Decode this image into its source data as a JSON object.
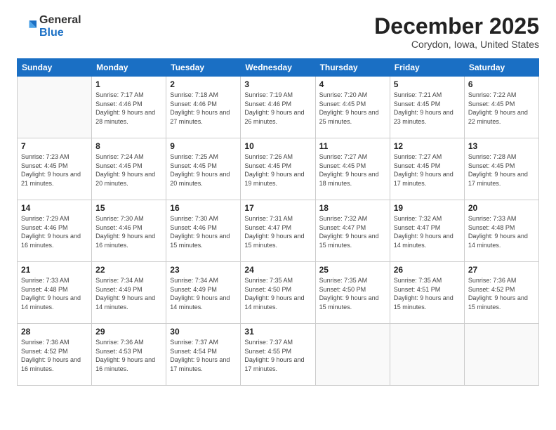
{
  "logo": {
    "general": "General",
    "blue": "Blue"
  },
  "title": "December 2025",
  "location": "Corydon, Iowa, United States",
  "weekdays": [
    "Sunday",
    "Monday",
    "Tuesday",
    "Wednesday",
    "Thursday",
    "Friday",
    "Saturday"
  ],
  "weeks": [
    [
      {
        "day": "",
        "sunrise": "",
        "sunset": "",
        "daylight": "",
        "empty": true
      },
      {
        "day": "1",
        "sunrise": "Sunrise: 7:17 AM",
        "sunset": "Sunset: 4:46 PM",
        "daylight": "Daylight: 9 hours and 28 minutes."
      },
      {
        "day": "2",
        "sunrise": "Sunrise: 7:18 AM",
        "sunset": "Sunset: 4:46 PM",
        "daylight": "Daylight: 9 hours and 27 minutes."
      },
      {
        "day": "3",
        "sunrise": "Sunrise: 7:19 AM",
        "sunset": "Sunset: 4:46 PM",
        "daylight": "Daylight: 9 hours and 26 minutes."
      },
      {
        "day": "4",
        "sunrise": "Sunrise: 7:20 AM",
        "sunset": "Sunset: 4:45 PM",
        "daylight": "Daylight: 9 hours and 25 minutes."
      },
      {
        "day": "5",
        "sunrise": "Sunrise: 7:21 AM",
        "sunset": "Sunset: 4:45 PM",
        "daylight": "Daylight: 9 hours and 23 minutes."
      },
      {
        "day": "6",
        "sunrise": "Sunrise: 7:22 AM",
        "sunset": "Sunset: 4:45 PM",
        "daylight": "Daylight: 9 hours and 22 minutes."
      }
    ],
    [
      {
        "day": "7",
        "sunrise": "Sunrise: 7:23 AM",
        "sunset": "Sunset: 4:45 PM",
        "daylight": "Daylight: 9 hours and 21 minutes."
      },
      {
        "day": "8",
        "sunrise": "Sunrise: 7:24 AM",
        "sunset": "Sunset: 4:45 PM",
        "daylight": "Daylight: 9 hours and 20 minutes."
      },
      {
        "day": "9",
        "sunrise": "Sunrise: 7:25 AM",
        "sunset": "Sunset: 4:45 PM",
        "daylight": "Daylight: 9 hours and 20 minutes."
      },
      {
        "day": "10",
        "sunrise": "Sunrise: 7:26 AM",
        "sunset": "Sunset: 4:45 PM",
        "daylight": "Daylight: 9 hours and 19 minutes."
      },
      {
        "day": "11",
        "sunrise": "Sunrise: 7:27 AM",
        "sunset": "Sunset: 4:45 PM",
        "daylight": "Daylight: 9 hours and 18 minutes."
      },
      {
        "day": "12",
        "sunrise": "Sunrise: 7:27 AM",
        "sunset": "Sunset: 4:45 PM",
        "daylight": "Daylight: 9 hours and 17 minutes."
      },
      {
        "day": "13",
        "sunrise": "Sunrise: 7:28 AM",
        "sunset": "Sunset: 4:45 PM",
        "daylight": "Daylight: 9 hours and 17 minutes."
      }
    ],
    [
      {
        "day": "14",
        "sunrise": "Sunrise: 7:29 AM",
        "sunset": "Sunset: 4:46 PM",
        "daylight": "Daylight: 9 hours and 16 minutes."
      },
      {
        "day": "15",
        "sunrise": "Sunrise: 7:30 AM",
        "sunset": "Sunset: 4:46 PM",
        "daylight": "Daylight: 9 hours and 16 minutes."
      },
      {
        "day": "16",
        "sunrise": "Sunrise: 7:30 AM",
        "sunset": "Sunset: 4:46 PM",
        "daylight": "Daylight: 9 hours and 15 minutes."
      },
      {
        "day": "17",
        "sunrise": "Sunrise: 7:31 AM",
        "sunset": "Sunset: 4:47 PM",
        "daylight": "Daylight: 9 hours and 15 minutes."
      },
      {
        "day": "18",
        "sunrise": "Sunrise: 7:32 AM",
        "sunset": "Sunset: 4:47 PM",
        "daylight": "Daylight: 9 hours and 15 minutes."
      },
      {
        "day": "19",
        "sunrise": "Sunrise: 7:32 AM",
        "sunset": "Sunset: 4:47 PM",
        "daylight": "Daylight: 9 hours and 14 minutes."
      },
      {
        "day": "20",
        "sunrise": "Sunrise: 7:33 AM",
        "sunset": "Sunset: 4:48 PM",
        "daylight": "Daylight: 9 hours and 14 minutes."
      }
    ],
    [
      {
        "day": "21",
        "sunrise": "Sunrise: 7:33 AM",
        "sunset": "Sunset: 4:48 PM",
        "daylight": "Daylight: 9 hours and 14 minutes."
      },
      {
        "day": "22",
        "sunrise": "Sunrise: 7:34 AM",
        "sunset": "Sunset: 4:49 PM",
        "daylight": "Daylight: 9 hours and 14 minutes."
      },
      {
        "day": "23",
        "sunrise": "Sunrise: 7:34 AM",
        "sunset": "Sunset: 4:49 PM",
        "daylight": "Daylight: 9 hours and 14 minutes."
      },
      {
        "day": "24",
        "sunrise": "Sunrise: 7:35 AM",
        "sunset": "Sunset: 4:50 PM",
        "daylight": "Daylight: 9 hours and 14 minutes."
      },
      {
        "day": "25",
        "sunrise": "Sunrise: 7:35 AM",
        "sunset": "Sunset: 4:50 PM",
        "daylight": "Daylight: 9 hours and 15 minutes."
      },
      {
        "day": "26",
        "sunrise": "Sunrise: 7:35 AM",
        "sunset": "Sunset: 4:51 PM",
        "daylight": "Daylight: 9 hours and 15 minutes."
      },
      {
        "day": "27",
        "sunrise": "Sunrise: 7:36 AM",
        "sunset": "Sunset: 4:52 PM",
        "daylight": "Daylight: 9 hours and 15 minutes."
      }
    ],
    [
      {
        "day": "28",
        "sunrise": "Sunrise: 7:36 AM",
        "sunset": "Sunset: 4:52 PM",
        "daylight": "Daylight: 9 hours and 16 minutes."
      },
      {
        "day": "29",
        "sunrise": "Sunrise: 7:36 AM",
        "sunset": "Sunset: 4:53 PM",
        "daylight": "Daylight: 9 hours and 16 minutes."
      },
      {
        "day": "30",
        "sunrise": "Sunrise: 7:37 AM",
        "sunset": "Sunset: 4:54 PM",
        "daylight": "Daylight: 9 hours and 17 minutes."
      },
      {
        "day": "31",
        "sunrise": "Sunrise: 7:37 AM",
        "sunset": "Sunset: 4:55 PM",
        "daylight": "Daylight: 9 hours and 17 minutes."
      },
      {
        "day": "",
        "sunrise": "",
        "sunset": "",
        "daylight": "",
        "empty": true
      },
      {
        "day": "",
        "sunrise": "",
        "sunset": "",
        "daylight": "",
        "empty": true
      },
      {
        "day": "",
        "sunrise": "",
        "sunset": "",
        "daylight": "",
        "empty": true
      }
    ]
  ]
}
